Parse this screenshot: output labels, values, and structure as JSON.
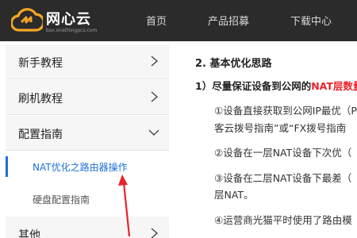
{
  "header": {
    "brand": "网心云",
    "brand_sub": "box.onethingpcs.com",
    "nav": {
      "home": "首页",
      "products": "产品招募",
      "download": "下载中心"
    }
  },
  "sidebar": {
    "items": [
      {
        "label": "新手教程"
      },
      {
        "label": "刷机教程"
      },
      {
        "label": "配置指南"
      },
      {
        "label": "其他"
      }
    ],
    "subitems": [
      {
        "label": "NAT优化之路由器操作"
      },
      {
        "label": "硬盘配置指南"
      }
    ]
  },
  "content": {
    "heading": "2. 基本优化思路",
    "subheading_prefix": "1）尽量保证设备到公网的",
    "subheading_red": "NAT层数量",
    "p1_line1": "①设备直接获取到公网IP最优（P",
    "p1_line2": "客云拨号指南”或“FX拨号指南",
    "p2_line1": "②设备在一层NAT设备下次优（",
    "p3_line1": "③设备在二层NAT设备下最差（",
    "p3_line2": "层NAT。",
    "p4_line1": "④运营商光猫平时使用了路由模"
  },
  "colors": {
    "topbar": "#2b2b2b",
    "active_link": "#1e6fd9",
    "highlight_red": "#e8232b"
  }
}
